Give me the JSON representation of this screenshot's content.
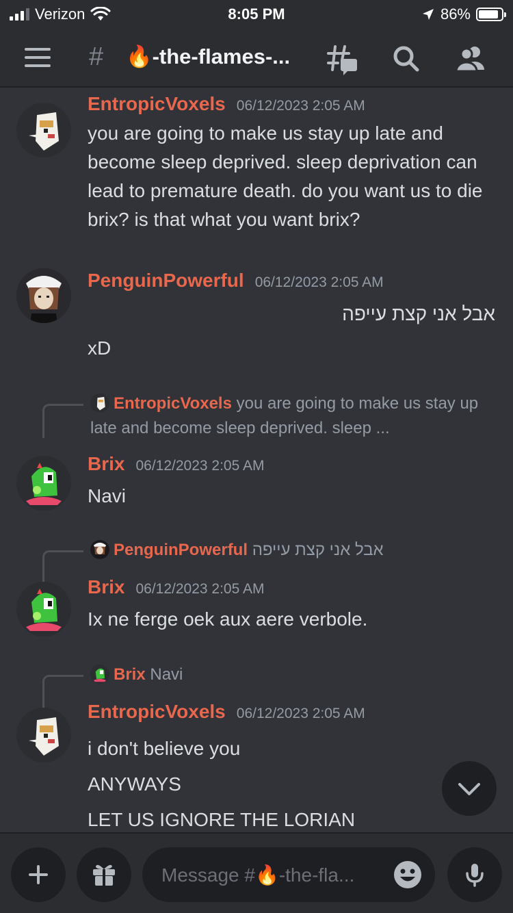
{
  "status_bar": {
    "carrier": "Verizon",
    "time": "8:05 PM",
    "battery": "86%",
    "battery_level": 0.86
  },
  "header": {
    "channel_hash": "#",
    "channel_name": "🔥-the-flames-...",
    "icons": [
      "menu-icon",
      "threads-icon",
      "search-icon",
      "members-icon"
    ]
  },
  "messages": [
    {
      "author": "EntropicVoxels",
      "timestamp": "06/12/2023 2:05 AM",
      "lines": [
        "you are going to make us stay up late and become sleep deprived. sleep deprivation can lead to premature death. do you want us to die brix? is that what you want brix?"
      ]
    },
    {
      "author": "PenguinPowerful",
      "timestamp": "06/12/2023 2:05 AM",
      "rtl_line": "אבל אני קצת עייפה",
      "line2": "xD"
    },
    {
      "reply_to": {
        "author": "EntropicVoxels",
        "text": "you are going to make us stay up late and become sleep deprived. sleep ..."
      },
      "author": "Brix",
      "timestamp": "06/12/2023 2:05 AM",
      "text": "Navi"
    },
    {
      "reply_to": {
        "author": "PenguinPowerful",
        "text": "אבל אני קצת עייפה"
      },
      "author": "Brix",
      "timestamp": "06/12/2023 2:05 AM",
      "text": "Ix ne ferge oek aux aere verbole."
    },
    {
      "reply_to": {
        "author": "Brix",
        "text": "Navi"
      },
      "author": "EntropicVoxels",
      "timestamp": "06/12/2023 2:05 AM",
      "lines": [
        "i don't believe you",
        "ANYWAYS",
        "LET US IGNORE THE LORIAN"
      ]
    }
  ],
  "composer": {
    "placeholder": "Message #🔥-the-fla..."
  },
  "colors": {
    "background": "#313338",
    "header": "#2b2d31",
    "username": "#e8674d",
    "text": "#dbdee1",
    "muted": "#949ba4"
  }
}
